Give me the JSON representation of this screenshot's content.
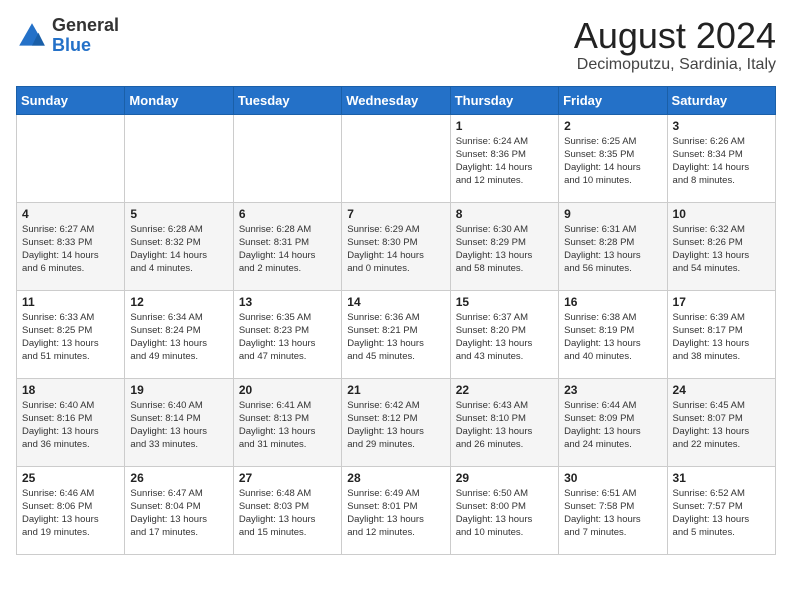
{
  "header": {
    "logo_general": "General",
    "logo_blue": "Blue",
    "month_year": "August 2024",
    "location": "Decimoputzu, Sardinia, Italy"
  },
  "days_of_week": [
    "Sunday",
    "Monday",
    "Tuesday",
    "Wednesday",
    "Thursday",
    "Friday",
    "Saturday"
  ],
  "weeks": [
    [
      {
        "day": "",
        "info": ""
      },
      {
        "day": "",
        "info": ""
      },
      {
        "day": "",
        "info": ""
      },
      {
        "day": "",
        "info": ""
      },
      {
        "day": "1",
        "info": "Sunrise: 6:24 AM\nSunset: 8:36 PM\nDaylight: 14 hours\nand 12 minutes."
      },
      {
        "day": "2",
        "info": "Sunrise: 6:25 AM\nSunset: 8:35 PM\nDaylight: 14 hours\nand 10 minutes."
      },
      {
        "day": "3",
        "info": "Sunrise: 6:26 AM\nSunset: 8:34 PM\nDaylight: 14 hours\nand 8 minutes."
      }
    ],
    [
      {
        "day": "4",
        "info": "Sunrise: 6:27 AM\nSunset: 8:33 PM\nDaylight: 14 hours\nand 6 minutes."
      },
      {
        "day": "5",
        "info": "Sunrise: 6:28 AM\nSunset: 8:32 PM\nDaylight: 14 hours\nand 4 minutes."
      },
      {
        "day": "6",
        "info": "Sunrise: 6:28 AM\nSunset: 8:31 PM\nDaylight: 14 hours\nand 2 minutes."
      },
      {
        "day": "7",
        "info": "Sunrise: 6:29 AM\nSunset: 8:30 PM\nDaylight: 14 hours\nand 0 minutes."
      },
      {
        "day": "8",
        "info": "Sunrise: 6:30 AM\nSunset: 8:29 PM\nDaylight: 13 hours\nand 58 minutes."
      },
      {
        "day": "9",
        "info": "Sunrise: 6:31 AM\nSunset: 8:28 PM\nDaylight: 13 hours\nand 56 minutes."
      },
      {
        "day": "10",
        "info": "Sunrise: 6:32 AM\nSunset: 8:26 PM\nDaylight: 13 hours\nand 54 minutes."
      }
    ],
    [
      {
        "day": "11",
        "info": "Sunrise: 6:33 AM\nSunset: 8:25 PM\nDaylight: 13 hours\nand 51 minutes."
      },
      {
        "day": "12",
        "info": "Sunrise: 6:34 AM\nSunset: 8:24 PM\nDaylight: 13 hours\nand 49 minutes."
      },
      {
        "day": "13",
        "info": "Sunrise: 6:35 AM\nSunset: 8:23 PM\nDaylight: 13 hours\nand 47 minutes."
      },
      {
        "day": "14",
        "info": "Sunrise: 6:36 AM\nSunset: 8:21 PM\nDaylight: 13 hours\nand 45 minutes."
      },
      {
        "day": "15",
        "info": "Sunrise: 6:37 AM\nSunset: 8:20 PM\nDaylight: 13 hours\nand 43 minutes."
      },
      {
        "day": "16",
        "info": "Sunrise: 6:38 AM\nSunset: 8:19 PM\nDaylight: 13 hours\nand 40 minutes."
      },
      {
        "day": "17",
        "info": "Sunrise: 6:39 AM\nSunset: 8:17 PM\nDaylight: 13 hours\nand 38 minutes."
      }
    ],
    [
      {
        "day": "18",
        "info": "Sunrise: 6:40 AM\nSunset: 8:16 PM\nDaylight: 13 hours\nand 36 minutes."
      },
      {
        "day": "19",
        "info": "Sunrise: 6:40 AM\nSunset: 8:14 PM\nDaylight: 13 hours\nand 33 minutes."
      },
      {
        "day": "20",
        "info": "Sunrise: 6:41 AM\nSunset: 8:13 PM\nDaylight: 13 hours\nand 31 minutes."
      },
      {
        "day": "21",
        "info": "Sunrise: 6:42 AM\nSunset: 8:12 PM\nDaylight: 13 hours\nand 29 minutes."
      },
      {
        "day": "22",
        "info": "Sunrise: 6:43 AM\nSunset: 8:10 PM\nDaylight: 13 hours\nand 26 minutes."
      },
      {
        "day": "23",
        "info": "Sunrise: 6:44 AM\nSunset: 8:09 PM\nDaylight: 13 hours\nand 24 minutes."
      },
      {
        "day": "24",
        "info": "Sunrise: 6:45 AM\nSunset: 8:07 PM\nDaylight: 13 hours\nand 22 minutes."
      }
    ],
    [
      {
        "day": "25",
        "info": "Sunrise: 6:46 AM\nSunset: 8:06 PM\nDaylight: 13 hours\nand 19 minutes."
      },
      {
        "day": "26",
        "info": "Sunrise: 6:47 AM\nSunset: 8:04 PM\nDaylight: 13 hours\nand 17 minutes."
      },
      {
        "day": "27",
        "info": "Sunrise: 6:48 AM\nSunset: 8:03 PM\nDaylight: 13 hours\nand 15 minutes."
      },
      {
        "day": "28",
        "info": "Sunrise: 6:49 AM\nSunset: 8:01 PM\nDaylight: 13 hours\nand 12 minutes."
      },
      {
        "day": "29",
        "info": "Sunrise: 6:50 AM\nSunset: 8:00 PM\nDaylight: 13 hours\nand 10 minutes."
      },
      {
        "day": "30",
        "info": "Sunrise: 6:51 AM\nSunset: 7:58 PM\nDaylight: 13 hours\nand 7 minutes."
      },
      {
        "day": "31",
        "info": "Sunrise: 6:52 AM\nSunset: 7:57 PM\nDaylight: 13 hours\nand 5 minutes."
      }
    ]
  ]
}
